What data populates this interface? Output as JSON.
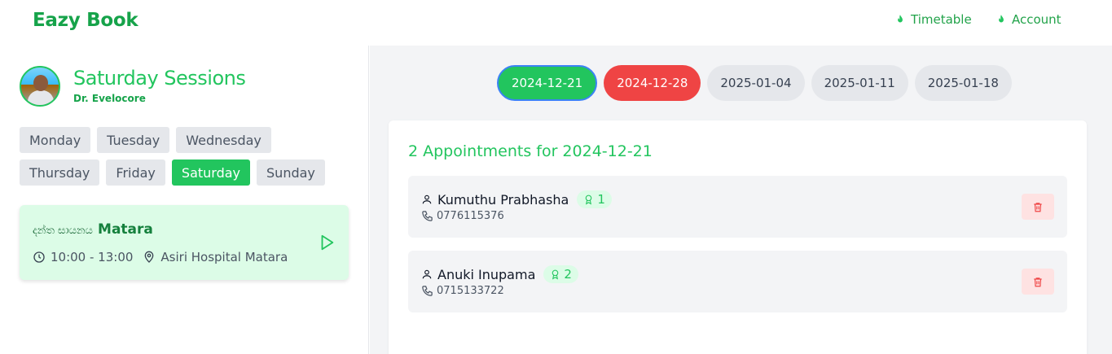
{
  "header": {
    "brand": "Eazy Book",
    "nav": [
      {
        "label": "Timetable",
        "icon": "flame-icon"
      },
      {
        "label": "Account",
        "icon": "flame-icon"
      }
    ]
  },
  "left": {
    "title": "Saturday Sessions",
    "doctor": "Dr. Evelocore",
    "days": [
      "Monday",
      "Tuesday",
      "Wednesday",
      "Thursday",
      "Friday",
      "Saturday",
      "Sunday"
    ],
    "active_day": "Saturday",
    "session": {
      "name": "දන්ත සායනය",
      "city": "Matara",
      "time": "10:00 - 13:00",
      "location": "Asiri Hospital Matara"
    }
  },
  "right": {
    "dates": [
      "2024-12-21",
      "2024-12-28",
      "2025-01-04",
      "2025-01-11",
      "2025-01-18"
    ],
    "selected_date": "2024-12-21",
    "heading": "2 Appointments for 2024-12-21",
    "appointments": [
      {
        "name": "Kumuthu Prabhasha",
        "number": "1",
        "phone": "0776115376"
      },
      {
        "name": "Anuki Inupama",
        "number": "2",
        "phone": "0715133722"
      }
    ]
  },
  "colors": {
    "accent": "#22c55e",
    "brand": "#16a34a",
    "danger": "#ef4444",
    "selected_border": "#3b82f6"
  }
}
